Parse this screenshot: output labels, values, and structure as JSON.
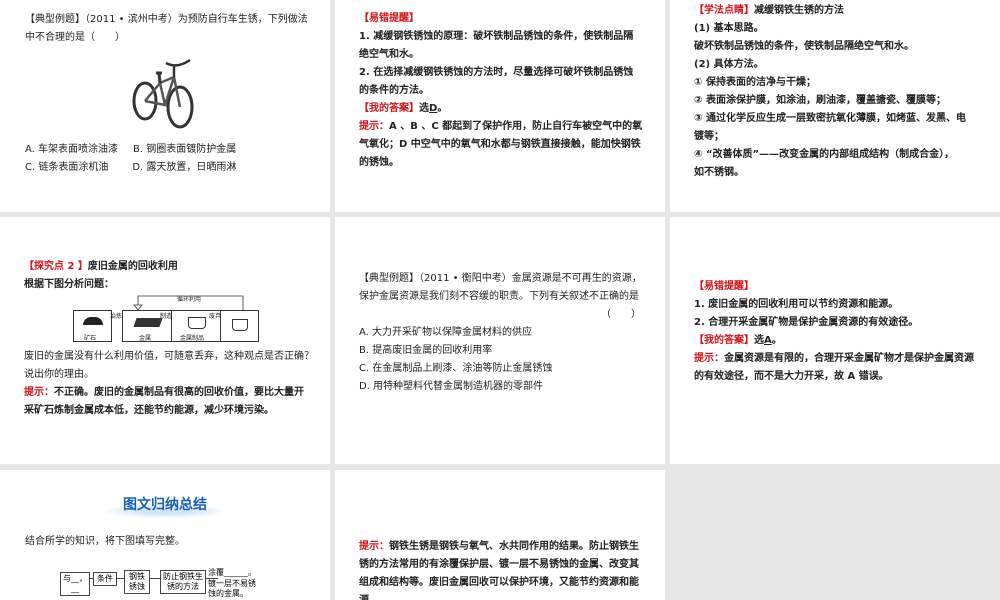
{
  "slide1": {
    "line1": "【典型例题】（2011 • 滨州中考）为预防自行车生锈，下列做法",
    "line2": "中不合理的是（　　）",
    "option_a": "A. 车架表面喷涂油漆",
    "option_b": "B. 钢圈表面镀防护金属",
    "option_c": "C. 链条表面涂机油",
    "option_d": "D. 露天放置，日晒雨淋"
  },
  "slide2": {
    "heading": "【易错提醒】",
    "lines": [
      "1. 减缓钢铁锈蚀的原理：破坏铁制品锈蚀的条件，使铁制品隔",
      "绝空气和水。",
      "2. 在选择减缓钢铁锈蚀的方法时，尽量选择可破坏铁制品锈蚀",
      "的条件的方法。"
    ],
    "answer_label": "【我的答案】",
    "answer_prefix": "选",
    "answer_value": "D",
    "answer_suffix": "。",
    "tip_label": "提示：",
    "tip_lines": [
      "A 、B 、C 都起到了保护作用，防止自行车被空气中的氧",
      "气氧化；D 中空气中的氧气和水都与钢铁直接接触，能加快钢铁",
      "的锈蚀。"
    ]
  },
  "slide3": {
    "heading": "【学法点睛】",
    "heading_rest": "减缓钢铁生锈的方法",
    "lines": [
      "(1) 基本思路。",
      "破坏铁制品锈蚀的条件，使铁制品隔绝空气和水。",
      "(2) 具体方法。",
      "① 保持表面的洁净与干燥；",
      "② 表面涂保护膜，如涂油，刷油漆，覆盖搪瓷、覆膜等；",
      "③ 通过化学反应生成一层致密抗氧化薄膜，如烤蓝、发黑、电",
      "镀等；",
      "④ “改善体质”——改变金属的内部组成结构（制成合金），",
      "如不锈钢。"
    ]
  },
  "slide4": {
    "heading": "【探究点 2 】",
    "heading_rest": "废旧金属的回收利用",
    "subheading": "根据下图分析问题：",
    "diagram": {
      "loop_label": "循环利用",
      "boxes": [
        "矿石",
        "金属",
        "金属制品",
        ""
      ],
      "arrows": [
        "冶炼",
        "制造",
        "废弃"
      ]
    },
    "question_lines": [
      "废旧的金属没有什么利用价值，可随意丢弃，这种观点是否正确？",
      "说出你的理由。"
    ],
    "tip_label": "提示：",
    "tip_lines": [
      "不正确。废旧的金属制品有很高的回收价值，要比大量开",
      "采矿石炼制金属成本低，还能节约能源，减少环境污染。"
    ]
  },
  "slide5": {
    "line1": "【典型例题】（2011 • 衡阳中考）金属资源是不可再生的资源，",
    "line2": "保护金属资源是我们刻不容缓的职责。下列有关叙述不正确的是",
    "paren": "（　　）",
    "options": [
      "A. 大力开采矿物以保障金属材料的供应",
      "B. 提高废旧金属的回收利用率",
      "C. 在金属制品上刷漆、涂油等防止金属锈蚀",
      "D. 用特种塑料代替金属制造机器的零部件"
    ]
  },
  "slide6": {
    "heading": "【易错提醒】",
    "lines": [
      "1. 废旧金属的回收利用可以节约资源和能源。",
      "2. 合理开采金属矿物是保护金属资源的有效途径。"
    ],
    "answer_label": "【我的答案】",
    "answer_prefix": "选",
    "answer_value": "A",
    "answer_suffix": "。",
    "tip_label": "提示：",
    "tip_lines": [
      "金属资源是有限的，合理开采金属矿物才是保护金属资源",
      "的有效途径，而不是大力开采，故 A 错误。"
    ]
  },
  "slide7": {
    "banner": "图文归纳总结",
    "instruction": "结合所学的知识，将下图填写完整。",
    "mindmap": {
      "box1": "与__，__",
      "box2": "条件",
      "box3": "钢铁锈蚀",
      "box4": "防止钢铁生锈的方法",
      "branch1": "涂覆______。",
      "branch2": "镀一层不易锈蚀的金属。"
    }
  },
  "slide8": {
    "tip_label": "提示：",
    "tip_lines": [
      "钢铁生锈是钢铁与氧气、水共同作用的结果。防止钢铁生",
      "锈的方法常用的有涂覆保护层、镀一层不易锈蚀的金属、改变其",
      "组成和结构等。废旧金属回收可以保护环境，又能节约资源和能",
      "源。"
    ]
  },
  "colors": {
    "accent_red": "#d0161b",
    "background": "#e6e6e6",
    "banner_blue": "#1a5fb4"
  }
}
